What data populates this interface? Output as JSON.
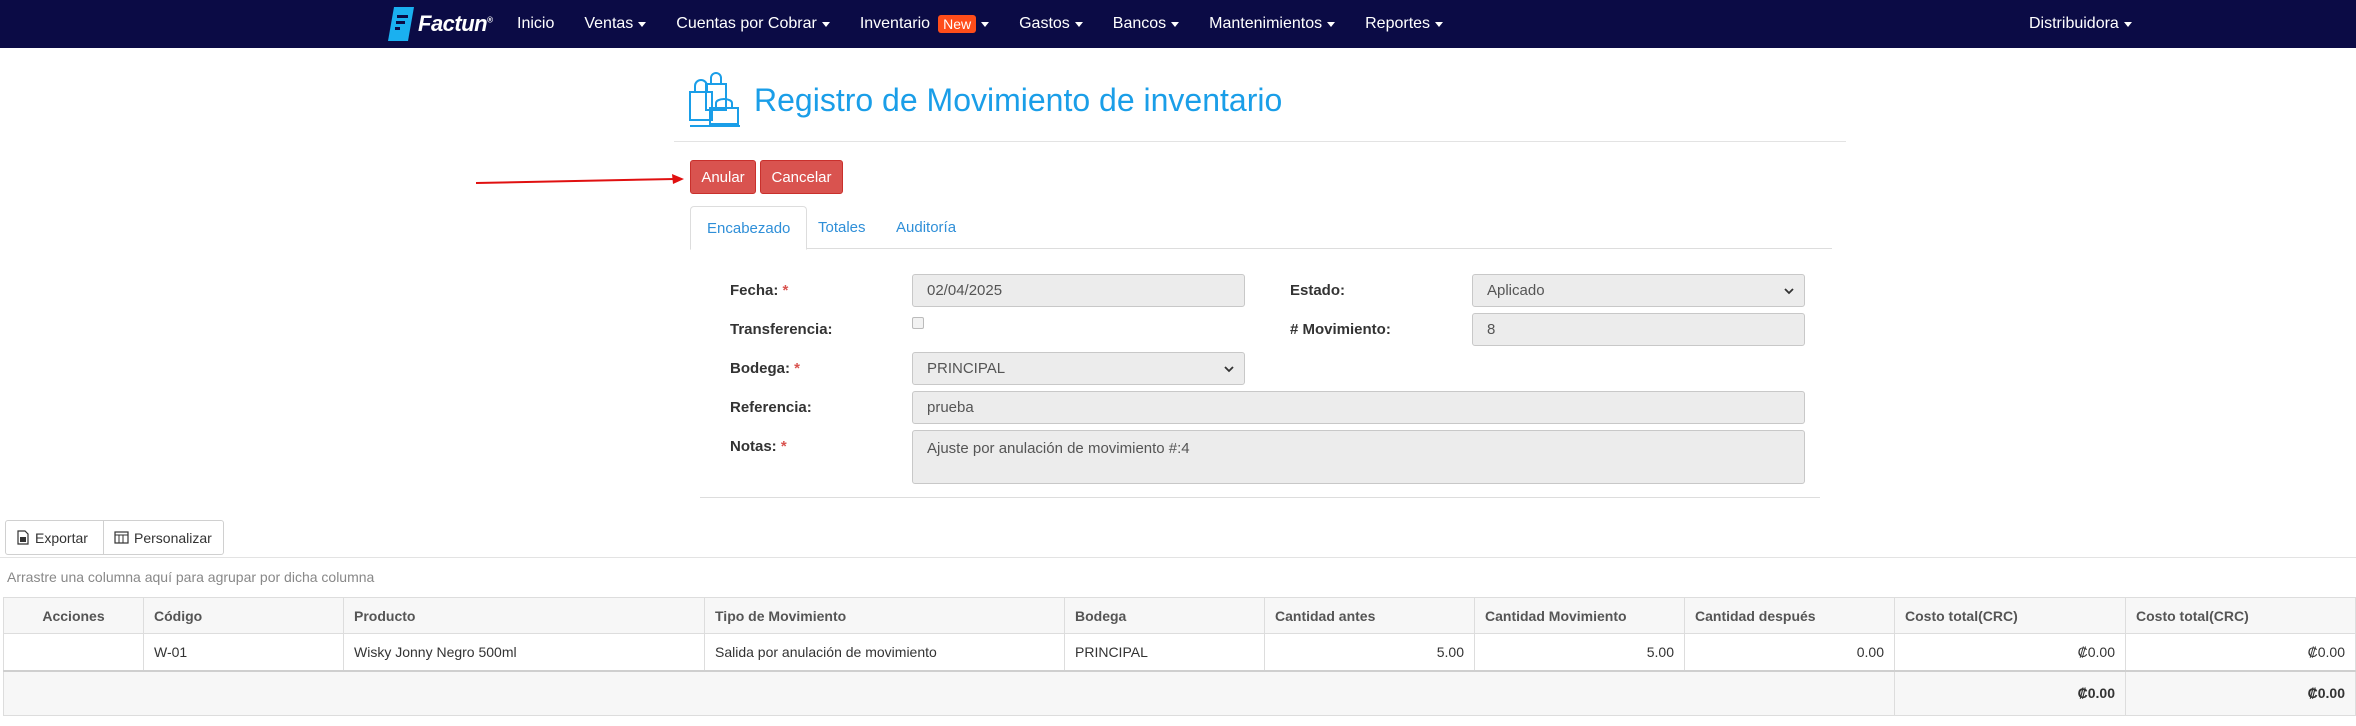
{
  "nav": {
    "brand": "Factun",
    "brand_mark": "®",
    "items": [
      {
        "label": "Inicio",
        "caret": false
      },
      {
        "label": "Ventas",
        "caret": true
      },
      {
        "label": "Cuentas por Cobrar",
        "caret": true
      },
      {
        "label": "Inventario",
        "caret": true,
        "badge": "New"
      },
      {
        "label": "Gastos",
        "caret": true
      },
      {
        "label": "Bancos",
        "caret": true
      },
      {
        "label": "Mantenimientos",
        "caret": true
      },
      {
        "label": "Reportes",
        "caret": true
      }
    ],
    "account": "Distribuidora"
  },
  "page": {
    "title": "Registro de Movimiento de inventario",
    "icon": "shopping-bags-icon"
  },
  "actions": {
    "anular": "Anular",
    "cancelar": "Cancelar"
  },
  "tabs": [
    {
      "label": "Encabezado",
      "active": true
    },
    {
      "label": "Totales",
      "active": false
    },
    {
      "label": "Auditoría",
      "active": false
    }
  ],
  "form": {
    "fecha_label": "Fecha:",
    "fecha_value": "02/04/2025",
    "estado_label": "Estado:",
    "estado_value": "Aplicado",
    "transferencia_label": "Transferencia:",
    "movimiento_label": "# Movimiento:",
    "movimiento_value": "8",
    "bodega_label": "Bodega:",
    "bodega_value": "PRINCIPAL",
    "referencia_label": "Referencia:",
    "referencia_value": "prueba",
    "notas_label": "Notas:",
    "notas_value": "Ajuste por anulación de movimiento #:4",
    "required_mark": "*"
  },
  "toolbar": {
    "exportar": "Exportar",
    "personalizar": "Personalizar",
    "group_hint": "Arrastre una columna aquí para agrupar por dicha columna"
  },
  "grid": {
    "headers": [
      "Acciones",
      "Código",
      "Producto",
      "Tipo de Movimiento",
      "Bodega",
      "Cantidad antes",
      "Cantidad Movimiento",
      "Cantidad después",
      "Costo total(CRC)",
      "Costo total(CRC)"
    ],
    "rows": [
      {
        "acciones": "",
        "codigo": "W-01",
        "producto": "Wisky Jonny Negro 500ml",
        "tipo": "Salida por anulación de movimiento",
        "bodega": "PRINCIPAL",
        "cant_antes": "5.00",
        "cant_mov": "5.00",
        "cant_despues": "0.00",
        "costo1": "₡0.00",
        "costo2": "₡0.00"
      }
    ],
    "footer": {
      "costo1": "₡0.00",
      "costo2": "₡0.00"
    }
  },
  "colors": {
    "navbar": "#0b0b45",
    "title": "#1a9ee8",
    "danger": "#d9534f",
    "badge": "#ff4d1a",
    "link": "#2f8fd8"
  }
}
